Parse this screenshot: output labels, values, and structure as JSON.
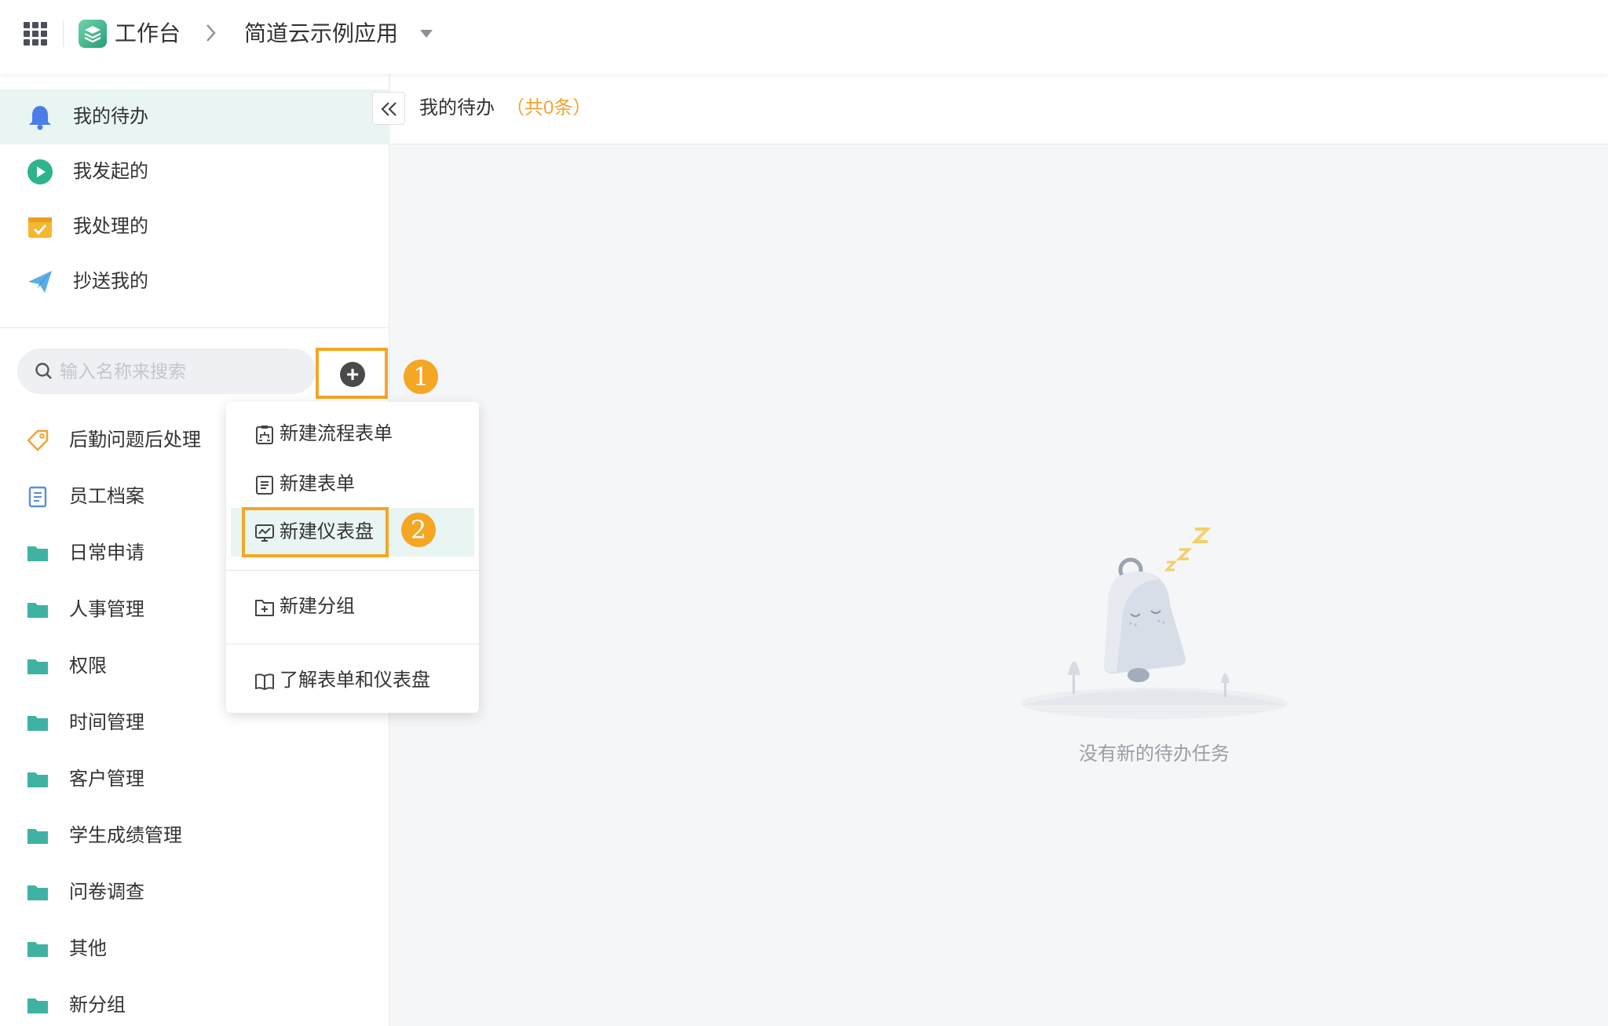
{
  "header": {
    "workspace": "工作台",
    "app_name": "简道云示例应用"
  },
  "sidebar": {
    "nav": [
      {
        "label": "我的待办",
        "icon": "bell-icon",
        "active": true
      },
      {
        "label": "我发起的",
        "icon": "play-circle-icon"
      },
      {
        "label": "我处理的",
        "icon": "check-box-icon"
      },
      {
        "label": "抄送我的",
        "icon": "paper-plane-icon"
      }
    ],
    "search_placeholder": "输入名称来搜索",
    "items": [
      {
        "label": "后勤问题后处理",
        "icon": "tag-icon"
      },
      {
        "label": "员工档案",
        "icon": "form-icon"
      },
      {
        "label": "日常申请",
        "icon": "folder-icon"
      },
      {
        "label": "人事管理",
        "icon": "folder-icon"
      },
      {
        "label": "权限",
        "icon": "folder-icon"
      },
      {
        "label": "时间管理",
        "icon": "folder-icon"
      },
      {
        "label": "客户管理",
        "icon": "folder-icon"
      },
      {
        "label": "学生成绩管理",
        "icon": "folder-icon"
      },
      {
        "label": "问卷调查",
        "icon": "folder-icon"
      },
      {
        "label": "其他",
        "icon": "folder-icon"
      },
      {
        "label": "新分组",
        "icon": "folder-icon"
      }
    ]
  },
  "menu": {
    "items": [
      {
        "label": "新建流程表单",
        "icon": "flow-form-icon"
      },
      {
        "label": "新建表单",
        "icon": "form-icon"
      },
      {
        "label": "新建仪表盘",
        "icon": "dashboard-icon",
        "highlighted": true
      },
      {
        "label": "新建分组",
        "icon": "folder-plus-icon"
      },
      {
        "label": "了解表单和仪表盘",
        "icon": "book-icon"
      }
    ]
  },
  "annotations": {
    "step1": "1",
    "step2": "2"
  },
  "main": {
    "title": "我的待办",
    "count": "（共0条）",
    "empty_text": "没有新的待办任务"
  },
  "colors": {
    "accent": "#2a9d8f",
    "highlight_bg": "#e8f5f3",
    "annotation": "#f5a623",
    "folder": "#3fb2a4"
  }
}
